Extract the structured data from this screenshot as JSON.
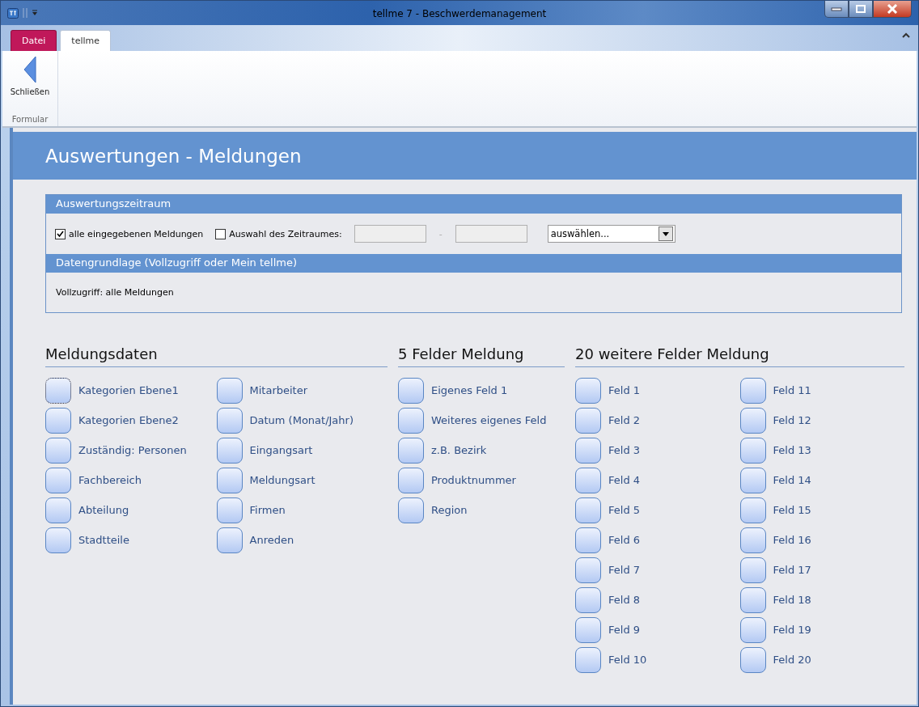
{
  "window": {
    "title": "tellme 7 - Beschwerdemanagement"
  },
  "ribbon": {
    "tabs": [
      {
        "label": "Datei",
        "kind": "file",
        "selected": false
      },
      {
        "label": "tellme",
        "kind": "tab",
        "selected": true
      }
    ],
    "groups": [
      {
        "label": "Formular",
        "buttons": [
          {
            "label": "Schließen"
          }
        ]
      }
    ]
  },
  "form": {
    "title": "Auswertungen - Meldungen",
    "period": {
      "header": "Auswertungszeitraum",
      "options": [
        {
          "label": "alle eingegebenen Meldungen",
          "checked": true
        },
        {
          "label": "Auswahl des Zeitraumes:",
          "checked": false
        }
      ],
      "separator": "-",
      "dropdown": {
        "value": "auswählen..."
      }
    },
    "basis": {
      "header": "Datengrundlage (Vollzugriff oder Mein tellme)",
      "text": "Vollzugriff: alle Meldungen"
    },
    "sections": [
      {
        "title": "Meldungsdaten",
        "columns": [
          [
            {
              "label": "Kategorien Ebene1",
              "focused": true
            },
            {
              "label": "Kategorien Ebene2",
              "focused": false
            },
            {
              "label": "Zuständig: Personen",
              "focused": false
            },
            {
              "label": "Fachbereich",
              "focused": false
            },
            {
              "label": "Abteilung",
              "focused": false
            },
            {
              "label": "Stadtteile",
              "focused": false
            }
          ],
          [
            {
              "label": "Mitarbeiter",
              "focused": false
            },
            {
              "label": "Datum (Monat/Jahr)",
              "focused": false
            },
            {
              "label": "Eingangsart",
              "focused": false
            },
            {
              "label": "Meldungsart",
              "focused": false
            },
            {
              "label": "Firmen",
              "focused": false
            },
            {
              "label": "Anreden",
              "focused": false
            }
          ]
        ]
      },
      {
        "title": "5 Felder Meldung",
        "columns": [
          [
            {
              "label": "Eigenes Feld 1",
              "focused": false
            },
            {
              "label": "Weiteres eigenes Feld",
              "focused": false
            },
            {
              "label": "z.B. Bezirk",
              "focused": false
            },
            {
              "label": "Produktnummer",
              "focused": false
            },
            {
              "label": "Region",
              "focused": false
            }
          ]
        ]
      },
      {
        "title": "20 weitere Felder Meldung",
        "columns": [
          [
            {
              "label": "Feld 1",
              "focused": false
            },
            {
              "label": "Feld 2",
              "focused": false
            },
            {
              "label": "Feld 3",
              "focused": false
            },
            {
              "label": "Feld 4",
              "focused": false
            },
            {
              "label": "Feld 5",
              "focused": false
            },
            {
              "label": "Feld 6",
              "focused": false
            },
            {
              "label": "Feld 7",
              "focused": false
            },
            {
              "label": "Feld 8",
              "focused": false
            },
            {
              "label": "Feld 9",
              "focused": false
            },
            {
              "label": "Feld 10",
              "focused": false
            }
          ],
          [
            {
              "label": "Feld 11",
              "focused": false
            },
            {
              "label": "Feld 12",
              "focused": false
            },
            {
              "label": "Feld 13",
              "focused": false
            },
            {
              "label": "Feld 14",
              "focused": false
            },
            {
              "label": "Feld 15",
              "focused": false
            },
            {
              "label": "Feld 16",
              "focused": false
            },
            {
              "label": "Feld 17",
              "focused": false
            },
            {
              "label": "Feld 18",
              "focused": false
            },
            {
              "label": "Feld 19",
              "focused": false
            },
            {
              "label": "Feld 20",
              "focused": false
            }
          ]
        ]
      }
    ]
  }
}
